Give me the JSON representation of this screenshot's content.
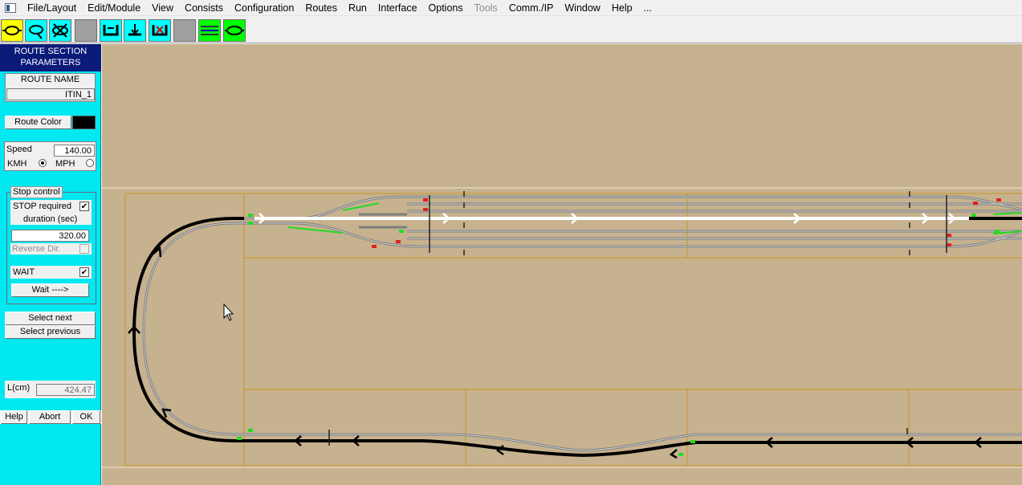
{
  "menu": {
    "items": [
      {
        "label": "File/Layout",
        "enabled": true
      },
      {
        "label": "Edit/Module",
        "enabled": true
      },
      {
        "label": "View",
        "enabled": true
      },
      {
        "label": "Consists",
        "enabled": true
      },
      {
        "label": "Configuration",
        "enabled": true
      },
      {
        "label": "Routes",
        "enabled": true
      },
      {
        "label": "Run",
        "enabled": true
      },
      {
        "label": "Interface",
        "enabled": true
      },
      {
        "label": "Options",
        "enabled": true
      },
      {
        "label": "Tools",
        "enabled": false
      },
      {
        "label": "Comm./IP",
        "enabled": true
      },
      {
        "label": "Window",
        "enabled": true
      },
      {
        "label": "Help",
        "enabled": true
      },
      {
        "label": "...",
        "enabled": true
      }
    ]
  },
  "toolbar": {
    "buttons": [
      {
        "name": "route-loop-icon",
        "color": "#ffff00"
      },
      {
        "name": "route-branch-icon",
        "color": "#00ffff"
      },
      {
        "name": "route-cross-icon",
        "color": "#00ffff"
      },
      {
        "name": "blank-tool-icon",
        "color": "#a0a0a0"
      },
      {
        "name": "bracket-up-icon",
        "color": "#00ffff"
      },
      {
        "name": "bracket-down-icon",
        "color": "#00ffff"
      },
      {
        "name": "bracket-x-icon",
        "color": "#00ffff"
      },
      {
        "name": "blank-tool-icon",
        "color": "#a0a0a0"
      },
      {
        "name": "parallel-lines-icon",
        "color": "#00ff00"
      },
      {
        "name": "oval-loop-icon",
        "color": "#00ff00"
      }
    ]
  },
  "panel": {
    "title_line1": "ROUTE SECTION",
    "title_line2": "PARAMETERS",
    "route_name_label": "ROUTE NAME",
    "route_name_value": "ITIN_1",
    "route_color_label": "Route Color",
    "route_color": "#000000",
    "speed_label": "Speed",
    "speed_value": "140.00",
    "kmh_label": "KMH",
    "mph_label": "MPH",
    "speed_unit_selected": "KMH",
    "stop_group_title": "Stop control",
    "stop_required_label": "STOP required",
    "stop_required_checked": true,
    "duration_label": "duration (sec)",
    "duration_value": "320.00",
    "reverse_label": "Reverse Dir.",
    "reverse_checked": false,
    "wait_label": "WAIT",
    "wait_checked": true,
    "wait_button": "Wait ---->",
    "select_next": "Select next",
    "select_previous": "Select previous",
    "length_label": "L(cm)",
    "length_value": "424.47",
    "help_button": "Help",
    "abort_button": "Abort",
    "ok_button": "OK"
  },
  "layout_colors": {
    "background": "#c7b28f",
    "module_border": "#c8961e",
    "track": "#8c8c8c",
    "active_route": "#000000",
    "selected_route": "#ffffff",
    "signal_green": "#22dd22",
    "signal_red": "#dd2222"
  }
}
